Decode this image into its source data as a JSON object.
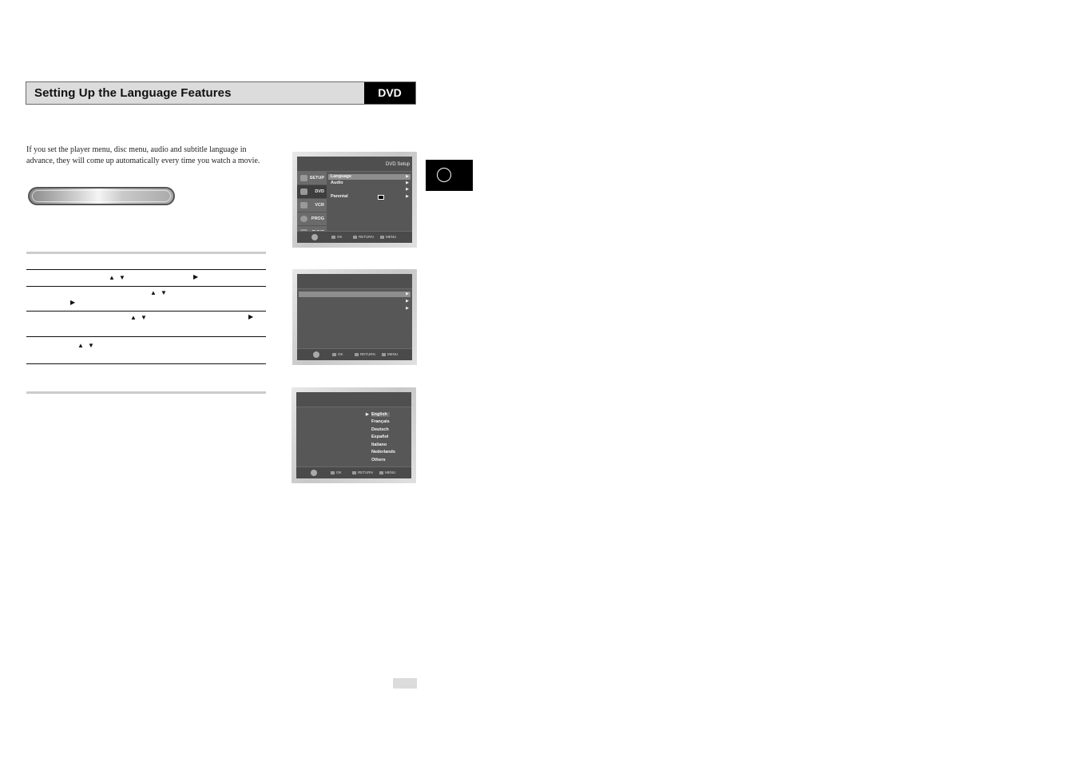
{
  "header": {
    "title": "Setting Up the Language Features",
    "badge": "DVD"
  },
  "intro": "If you set the player menu, disc menu, audio and subtitle language in advance, they will come up automatically every time you watch a movie.",
  "steps": [
    {
      "icons": [
        "up-down-arrows",
        "right-arrow"
      ]
    },
    {
      "icons": [
        "up-down-arrows",
        "right-arrow"
      ]
    },
    {
      "icons": [
        "up-down-arrows",
        "right-arrow"
      ]
    },
    {
      "icons": [
        "up-down-arrows"
      ]
    }
  ],
  "glyphs": {
    "up": "▲",
    "down": "▼",
    "right": "▶"
  },
  "screen1": {
    "title": "DVD Setup",
    "sidebar": [
      "SETUP",
      "DVD",
      "VCR",
      "PROG",
      "FUNC"
    ],
    "menu": [
      {
        "label": "Language",
        "arrow": "▶"
      },
      {
        "label": "Audio",
        "arrow": "▶"
      },
      {
        "label": "",
        "arrow": "▶"
      },
      {
        "label": "Parental",
        "arrow": "▶"
      }
    ]
  },
  "screen2": {
    "menu": [
      {
        "arrow": "▶"
      },
      {
        "arrow": "▶"
      },
      {
        "arrow": "▶"
      }
    ]
  },
  "screen3": {
    "selected_marker": "▶",
    "languages": [
      "English",
      "Français",
      "Deutsch",
      "Español",
      "Italiano",
      "Nederlands",
      "Others"
    ]
  },
  "footer": {
    "ok": "OK",
    "return": "RETURN",
    "menu": "MENU"
  }
}
